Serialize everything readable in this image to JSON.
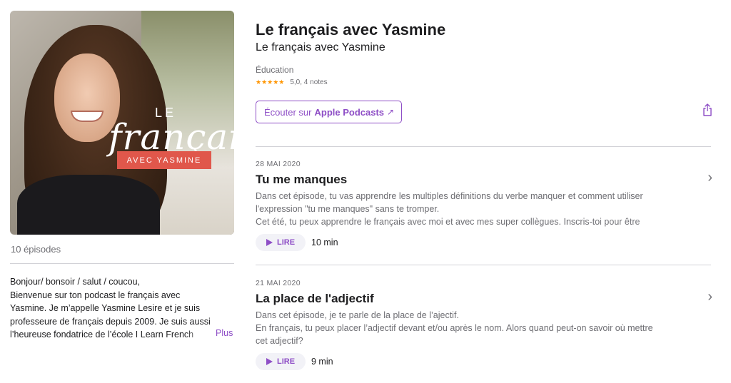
{
  "artwork": {
    "logo_le": "LE",
    "logo_script": "français",
    "logo_banner": "AVEC YASMINE"
  },
  "sidebar": {
    "episodes_count": "10 épisodes",
    "description_lines": [
      "Bonjour/ bonsoir / salut / coucou,",
      "Bienvenue sur ton podcast le français avec",
      "Yasmine. Je m’appelle Yasmine Lesire et je suis",
      "professeure de français depuis 2009. Je suis aussi",
      "l’heureuse fondatrice de l’école I Learn French"
    ],
    "more_label": "Plus"
  },
  "header": {
    "title": "Le français avec Yasmine",
    "author": "Le français avec Yasmine",
    "category": "Éducation",
    "stars": "★★★★★",
    "rating_text": "5,0, 4 notes",
    "listen_prefix": "Écouter sur",
    "listen_brand": "Apple Podcasts",
    "listen_arrow": "↗",
    "share_icon": "share-icon"
  },
  "episodes": [
    {
      "date": "28 MAI 2020",
      "title": "Tu me manques",
      "desc_lines": [
        "Dans cet épisode, tu vas apprendre les multiples définitions du verbe manquer et comment utiliser",
        "l'expression \"tu me manques\" sans te tromper.",
        "Cet été, tu peux apprendre le français avec moi et avec mes super collègues. Inscris-toi pour être"
      ],
      "play_label": "LIRE",
      "duration": "10 min",
      "chevron": "›"
    },
    {
      "date": "21 MAI 2020",
      "title": "La place de l'adjectif",
      "desc_lines": [
        "Dans cet épisode, je te parle de la place de l’ajectif.",
        "En français, tu peux placer l’adjectif devant et/ou après le nom. Alors quand peut-on savoir où mettre",
        "cet adjectif?"
      ],
      "play_label": "LIRE",
      "duration": "9 min",
      "chevron": "›"
    }
  ],
  "colors": {
    "accent": "#8e4ec6",
    "star": "#ff9500",
    "banner": "#e0574b"
  }
}
